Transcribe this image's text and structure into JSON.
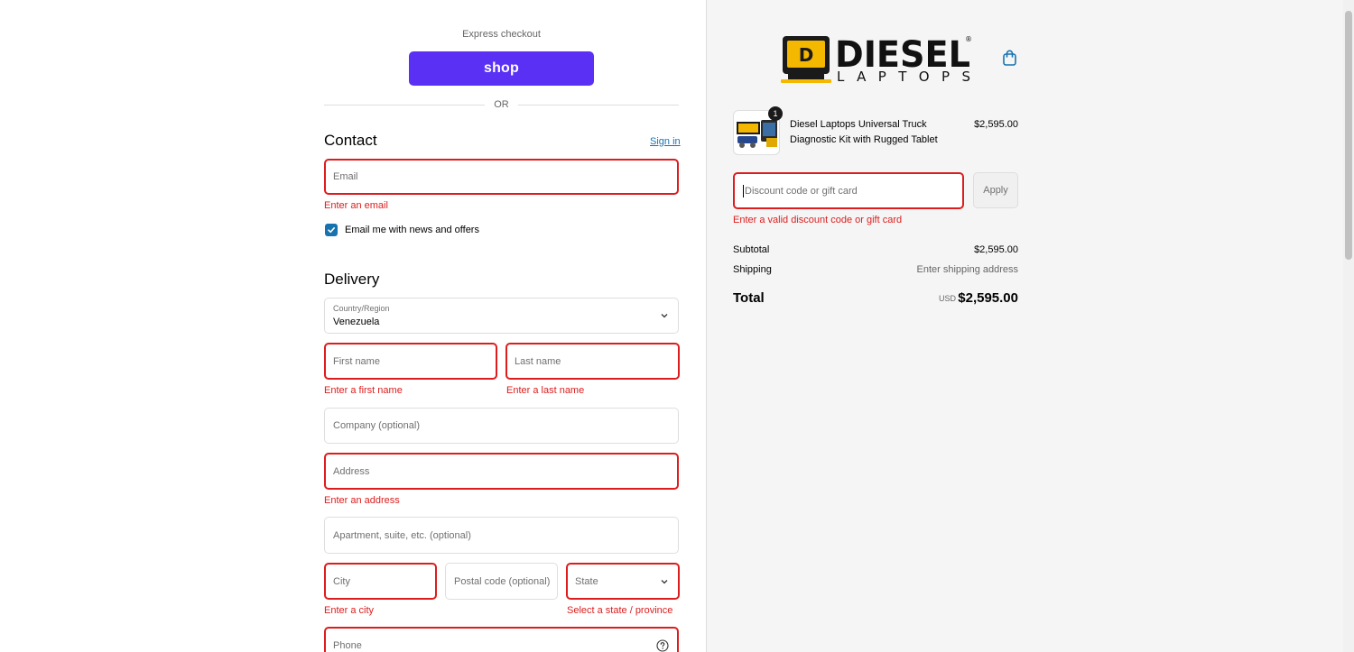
{
  "express": {
    "title": "Express checkout",
    "shop_label": "shop",
    "or_label": "OR"
  },
  "contact": {
    "heading": "Contact",
    "sign_in": "Sign in",
    "email_placeholder": "Email",
    "email_error": "Enter an email",
    "newsletter_label": "Email me with news and offers",
    "newsletter_checked": true
  },
  "delivery": {
    "heading": "Delivery",
    "country_label": "Country/Region",
    "country_value": "Venezuela",
    "first_name_placeholder": "First name",
    "first_name_error": "Enter a first name",
    "last_name_placeholder": "Last name",
    "last_name_error": "Enter a last name",
    "company_placeholder": "Company (optional)",
    "address_placeholder": "Address",
    "address_error": "Enter an address",
    "apartment_placeholder": "Apartment, suite, etc. (optional)",
    "city_placeholder": "City",
    "city_error": "Enter a city",
    "postal_placeholder": "Postal code (optional)",
    "state_placeholder": "State",
    "state_error": "Select a state / province",
    "phone_placeholder": "Phone"
  },
  "summary": {
    "logo_text_top": "DIESEL",
    "logo_text_bottom": "LAPTOPS",
    "logo_mark_letter": "D",
    "registered_mark": "®",
    "product": {
      "name": "Diesel Laptops Universal Truck Diagnostic Kit with Rugged Tablet",
      "price": "$2,595.00",
      "quantity": "1"
    },
    "discount_placeholder": "Discount code or gift card",
    "discount_error": "Enter a valid discount code or gift card",
    "apply_label": "Apply",
    "subtotal_label": "Subtotal",
    "subtotal_value": "$2,595.00",
    "shipping_label": "Shipping",
    "shipping_value": "Enter shipping address",
    "total_label": "Total",
    "total_currency": "USD",
    "total_value": "$2,595.00"
  },
  "colors": {
    "shop_purple": "#5a31f4",
    "error_red": "#dd1d1d",
    "link_blue": "#1773b0",
    "logo_yellow": "#f5b800"
  }
}
